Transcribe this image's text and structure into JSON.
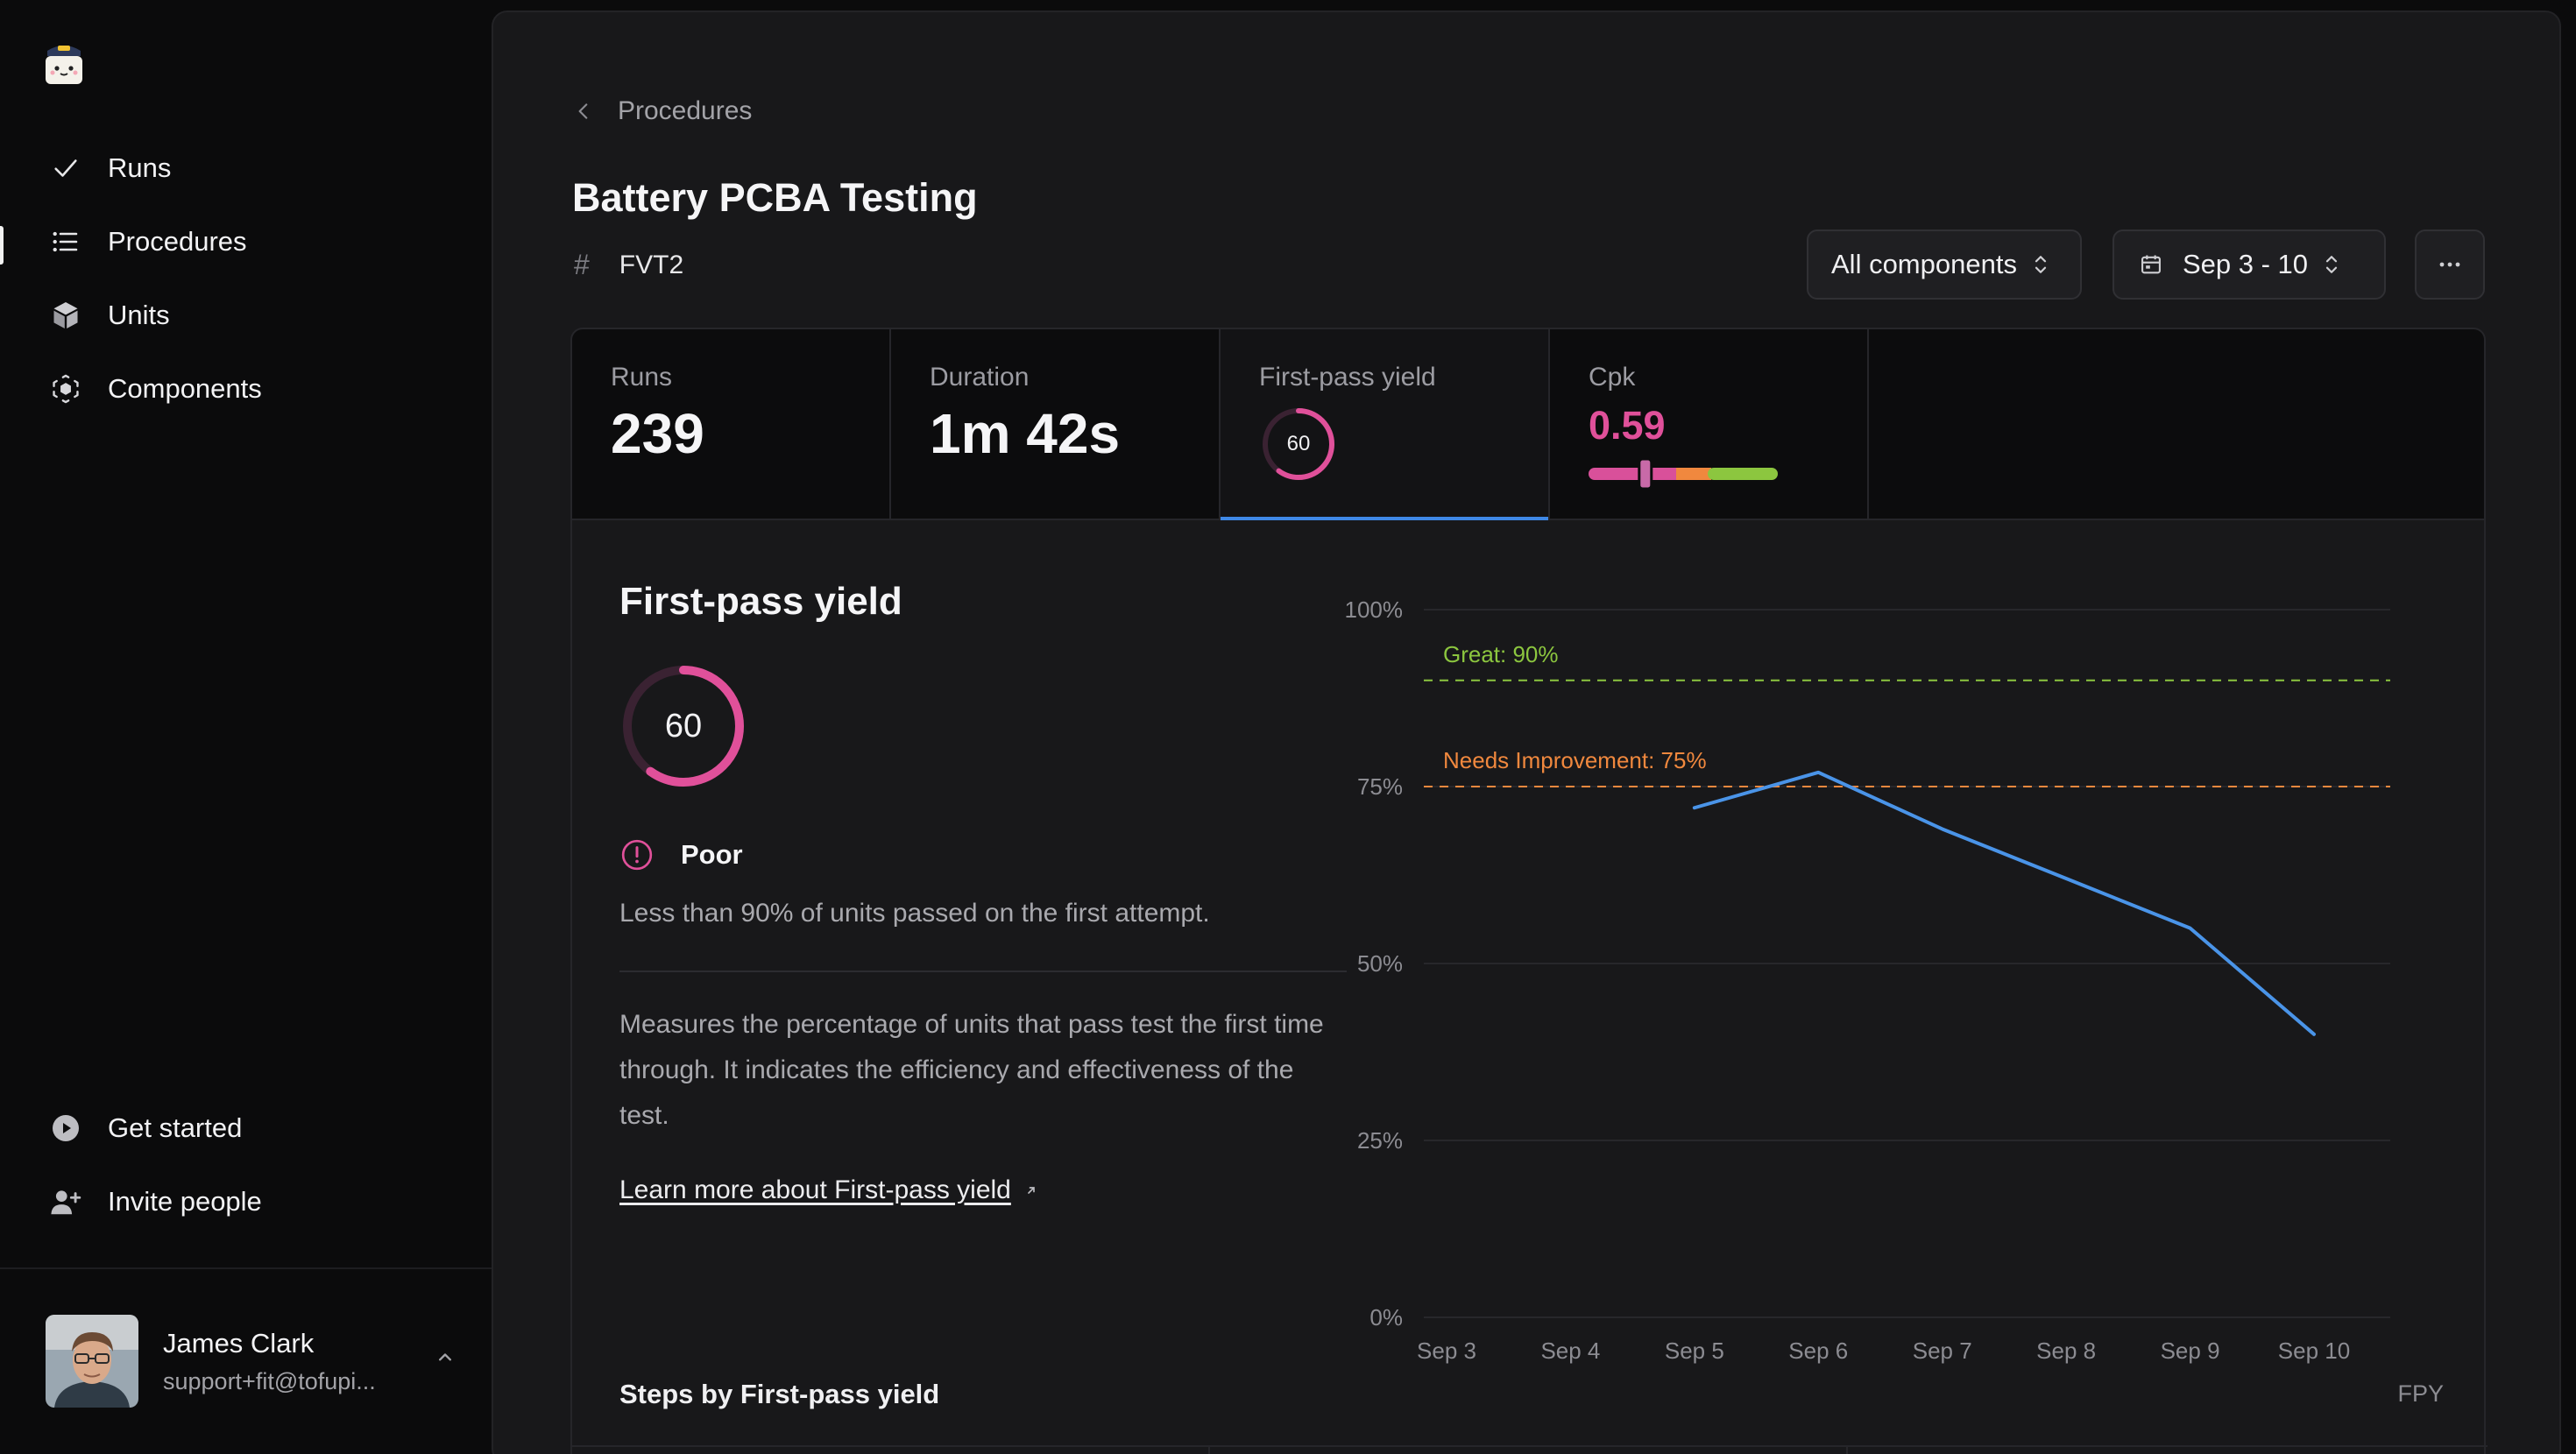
{
  "sidebar": {
    "nav": [
      {
        "label": "Runs",
        "icon": "check-icon"
      },
      {
        "label": "Procedures",
        "icon": "list-icon",
        "active": true
      },
      {
        "label": "Units",
        "icon": "cube-icon"
      },
      {
        "label": "Components",
        "icon": "components-icon"
      }
    ],
    "bottom": [
      {
        "label": "Get started",
        "icon": "play-circle-icon"
      },
      {
        "label": "Invite people",
        "icon": "user-plus-icon"
      }
    ],
    "user": {
      "name": "James Clark",
      "email": "support+fit@tofupi..."
    }
  },
  "header": {
    "breadcrumb": "Procedures",
    "title": "Battery PCBA Testing",
    "tag": "FVT2",
    "filters": {
      "components": "All components",
      "date_range": "Sep 3 - 10"
    }
  },
  "metrics": {
    "runs": {
      "label": "Runs",
      "value": "239"
    },
    "duration": {
      "label": "Duration",
      "value": "1m 42s"
    },
    "fpy": {
      "label": "First-pass yield",
      "value": "60",
      "percent": 60
    },
    "cpk": {
      "label": "Cpk",
      "value": "0.59",
      "indicator_fraction": 0.3
    }
  },
  "detail": {
    "title": "First-pass yield",
    "score": "60",
    "score_percent": 60,
    "status": "Poor",
    "status_text": "Less than 90% of units passed on the first attempt.",
    "description": "Measures the percentage of units that pass test the first time through. It indicates the efficiency and effectiveness of the test.",
    "learn_more": "Learn more about First-pass yield",
    "steps_title": "Steps by First-pass yield",
    "steps_column": "FPY"
  },
  "colors": {
    "accent_blue": "#3f88e6",
    "poor_pink": "#e0509a",
    "great_green": "#8cc63f",
    "needs_orange": "#f0883e"
  },
  "chart_data": {
    "type": "line",
    "x": [
      "Sep 3",
      "Sep 4",
      "Sep 5",
      "Sep 6",
      "Sep 7",
      "Sep 8",
      "Sep 9",
      "Sep 10"
    ],
    "series": [
      {
        "values": [
          null,
          null,
          72,
          77,
          69,
          62,
          55,
          40
        ]
      }
    ],
    "ylim": [
      0,
      100
    ],
    "y_ticks": [
      "0%",
      "25%",
      "50%",
      "75%",
      "100%"
    ],
    "thresholds": [
      {
        "label": "Great: 90%",
        "value": 90,
        "color": "#8cc63f"
      },
      {
        "label": "Needs Improvement: 75%",
        "value": 75,
        "color": "#f0883e"
      }
    ],
    "grid": true
  }
}
